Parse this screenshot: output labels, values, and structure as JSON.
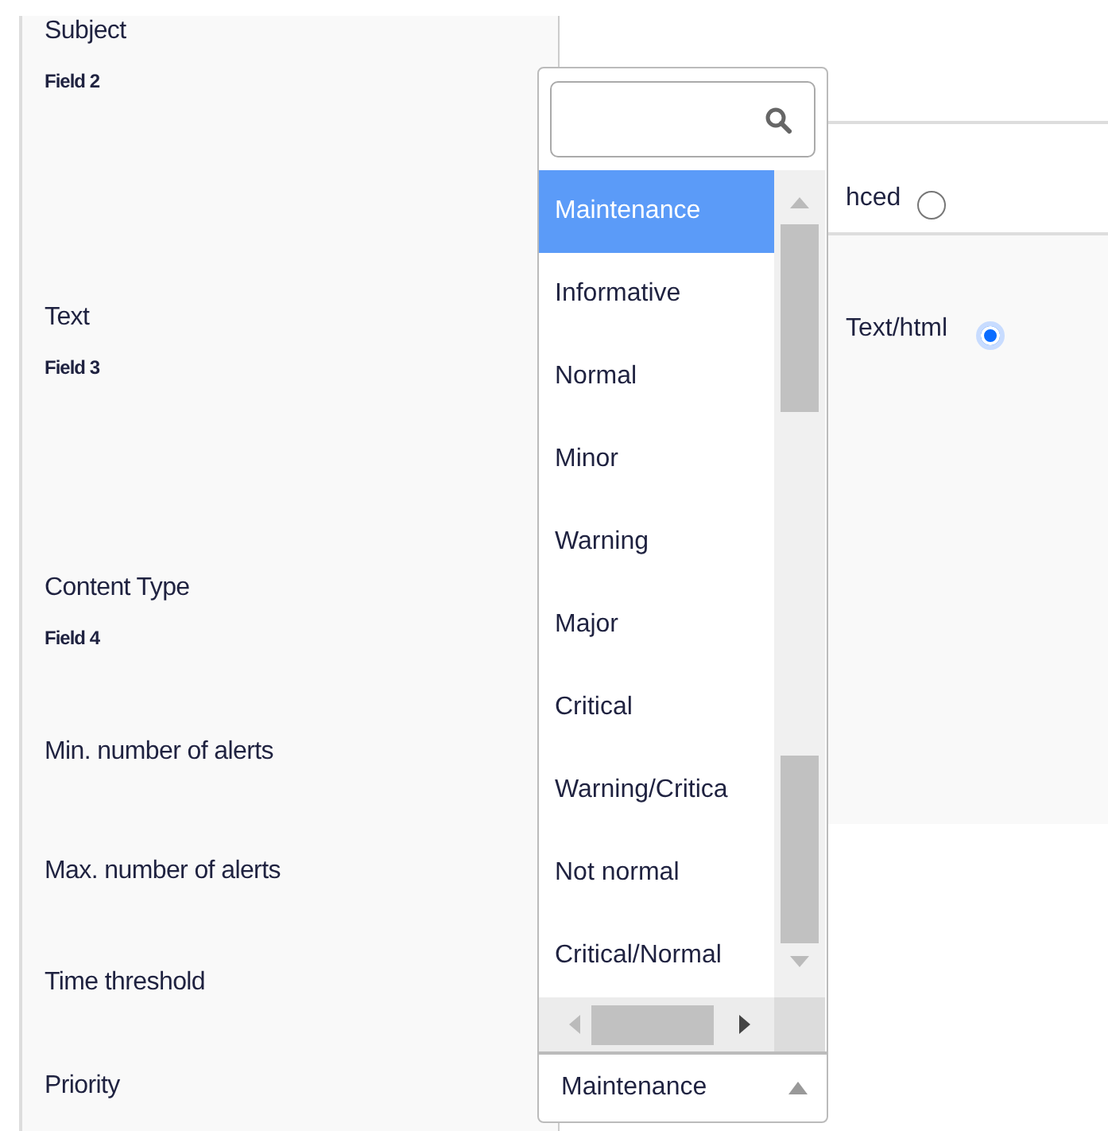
{
  "fields": [
    {
      "label": "Subject",
      "sublabel": "Field 2"
    },
    {
      "label": "Text",
      "sublabel": "Field 3"
    },
    {
      "label": "Content Type",
      "sublabel": "Field 4"
    },
    {
      "label": "Min. number of alerts"
    },
    {
      "label": "Max. number of alerts"
    },
    {
      "label": "Time threshold"
    },
    {
      "label": "Priority"
    }
  ],
  "options": [
    {
      "label": "hced",
      "selected": false
    },
    {
      "label": "Text/html",
      "selected": true
    }
  ],
  "dropdown": {
    "items": [
      {
        "label": "Maintenance",
        "selected": true
      },
      {
        "label": "Informative",
        "selected": false
      },
      {
        "label": "Normal",
        "selected": false
      },
      {
        "label": "Minor",
        "selected": false
      },
      {
        "label": "Warning",
        "selected": false
      },
      {
        "label": "Major",
        "selected": false
      },
      {
        "label": "Critical",
        "selected": false
      },
      {
        "label": "Warning/Critica",
        "selected": false
      },
      {
        "label": "Not normal",
        "selected": false
      },
      {
        "label": "Critical/Normal",
        "selected": false
      }
    ],
    "value": "Maintenance"
  }
}
